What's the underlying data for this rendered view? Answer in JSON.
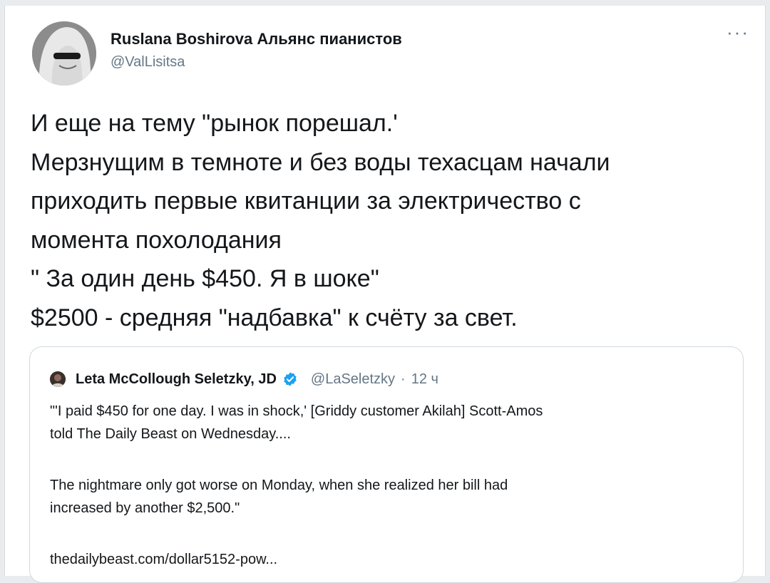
{
  "author": {
    "name": "Ruslana Boshirova Альянс пианистов",
    "handle": "@ValLisitsa"
  },
  "more_menu": "···",
  "tweet_lines": [
    "И еще на тему \"рынок порешал.'",
    "Мерзнущим в темноте и без воды техасцам начали",
    "приходить первые квитанции за электричество с",
    "момента похолодания",
    "\" За один день $450. Я в шоке\"",
    "$2500 - средняя \"надбавка\" к счёту за свет."
  ],
  "quoted": {
    "name": "Leta McCollough Seletzky, JD",
    "handle": "@LaSeletzky",
    "separator": "·",
    "time": "12 ч",
    "body_lines": [
      "\"'I paid $450 for one day. I was in shock,' [Griddy customer Akilah] Scott-Amos",
      "told The Daily Beast on Wednesday....",
      "The nightmare only got worse on Monday, when she realized her bill had",
      "increased by another $2,500.\"",
      "thedailybeast.com/dollar5152-pow..."
    ]
  },
  "colors": {
    "text": "#14171a",
    "secondary": "#657786",
    "verified": "#1da1f2",
    "border": "#cfd9de"
  }
}
